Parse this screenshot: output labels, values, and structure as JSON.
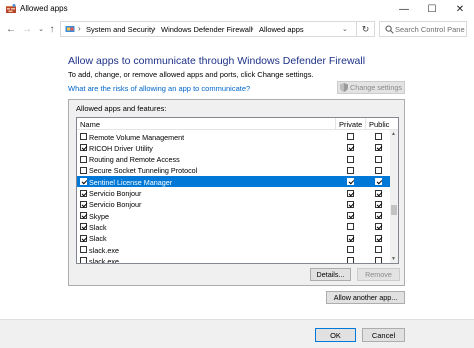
{
  "window": {
    "title": "Allowed apps",
    "minimize_glyph": "—",
    "maximize_glyph": "☐",
    "close_glyph": "✕"
  },
  "nav": {
    "back_glyph": "←",
    "forward_glyph": "→",
    "recent_glyph": "⌄",
    "up_glyph": "↑"
  },
  "address": {
    "breadcrumbs": [
      "System and Security",
      "Windows Defender Firewall",
      "Allowed apps"
    ],
    "separator": "›",
    "dropdown_glyph": "⌄",
    "refresh_glyph": "↻"
  },
  "search": {
    "placeholder": "Search Control Panel"
  },
  "main": {
    "heading": "Allow apps to communicate through Windows Defender Firewall",
    "subheading": "To add, change, or remove allowed apps and ports, click Change settings.",
    "risk_link": "What are the risks of allowing an app to communicate?",
    "change_settings_label": "Change settings"
  },
  "apps_list": {
    "group_label": "Allowed apps and features:",
    "columns": {
      "name": "Name",
      "private": "Private",
      "public": "Public"
    },
    "rows": [
      {
        "name": "Remote Volume Management",
        "enabled": false,
        "private": false,
        "public": false,
        "selected": false
      },
      {
        "name": "RICOH Driver Utility",
        "enabled": true,
        "private": true,
        "public": true,
        "selected": false
      },
      {
        "name": "Routing and Remote Access",
        "enabled": false,
        "private": false,
        "public": false,
        "selected": false
      },
      {
        "name": "Secure Socket Tunneling Protocol",
        "enabled": false,
        "private": false,
        "public": false,
        "selected": false
      },
      {
        "name": "Sentinel License Manager",
        "enabled": true,
        "private": true,
        "public": true,
        "selected": true
      },
      {
        "name": "Servicio Bonjour",
        "enabled": true,
        "private": true,
        "public": true,
        "selected": false
      },
      {
        "name": "Servicio Bonjour",
        "enabled": true,
        "private": true,
        "public": true,
        "selected": false
      },
      {
        "name": "Skype",
        "enabled": true,
        "private": true,
        "public": true,
        "selected": false
      },
      {
        "name": "Slack",
        "enabled": true,
        "private": false,
        "public": true,
        "selected": false
      },
      {
        "name": "Slack",
        "enabled": true,
        "private": true,
        "public": true,
        "selected": false
      },
      {
        "name": "slack.exe",
        "enabled": false,
        "private": false,
        "public": false,
        "selected": false
      },
      {
        "name": "slack.exe",
        "enabled": false,
        "private": false,
        "public": false,
        "selected": false
      }
    ],
    "details_label": "Details...",
    "remove_label": "Remove",
    "scroll_up_glyph": "▲",
    "scroll_down_glyph": "▼"
  },
  "allow_another_label": "Allow another app...",
  "footer": {
    "ok_label": "OK",
    "cancel_label": "Cancel"
  },
  "colors": {
    "heading": "#1e3287",
    "link": "#0066cc",
    "selection": "#0078d7",
    "footer_bg": "#f0f0f0"
  },
  "icons": {
    "app": "firewall-app-icon",
    "address": "control-panel-icon",
    "search": "search-icon",
    "change_settings": "uac-shield-icon"
  }
}
